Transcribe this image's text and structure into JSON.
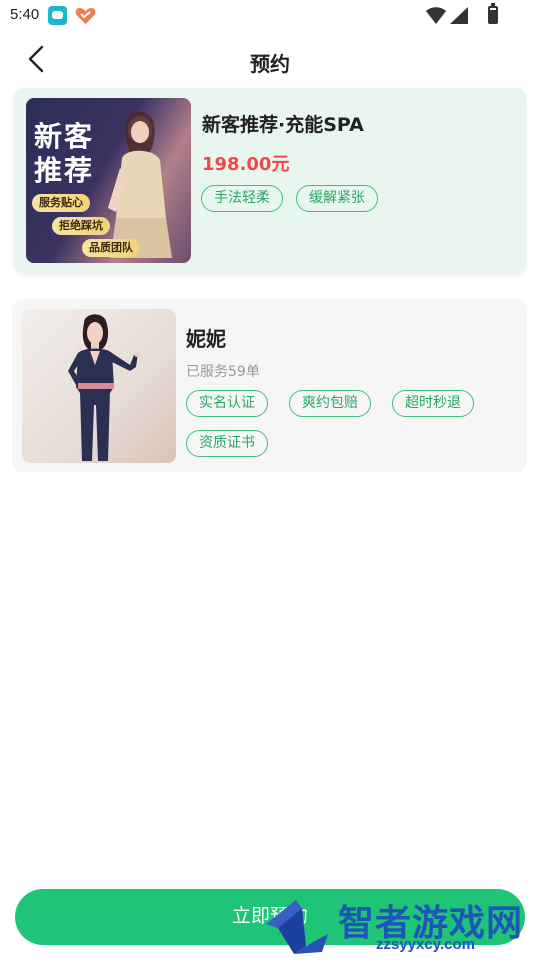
{
  "status_bar": {
    "time": "5:40"
  },
  "header": {
    "title": "预约"
  },
  "service": {
    "image_text": {
      "line1": "新客",
      "line2": "推荐",
      "ribbon1": "服务贴心",
      "ribbon2": "拒绝踩坑",
      "ribbon3": "品质团队"
    },
    "name": "新客推荐·充能SPA",
    "price": "198.00元",
    "tags": [
      "手法轻柔",
      "缓解紧张"
    ]
  },
  "therapist": {
    "name": "妮妮",
    "served": "已服务59单",
    "tags": [
      "实名认证",
      "爽约包赔",
      "超时秒退",
      "资质证书"
    ]
  },
  "footer": {
    "book_label": "立即预约"
  },
  "watermark": {
    "text": "智者游戏网",
    "url": "zzsyyxcy.com"
  },
  "colors": {
    "primary": "#1fc477",
    "price": "#f04a48",
    "tag_border": "#3cc07d",
    "service_card_bg": "#e9f6ef",
    "therapist_card_bg": "#f6f6f6"
  },
  "icons": {
    "back": "chevron-left-icon",
    "wifi": "wifi-icon",
    "signal": "signal-icon",
    "battery": "battery-icon"
  }
}
